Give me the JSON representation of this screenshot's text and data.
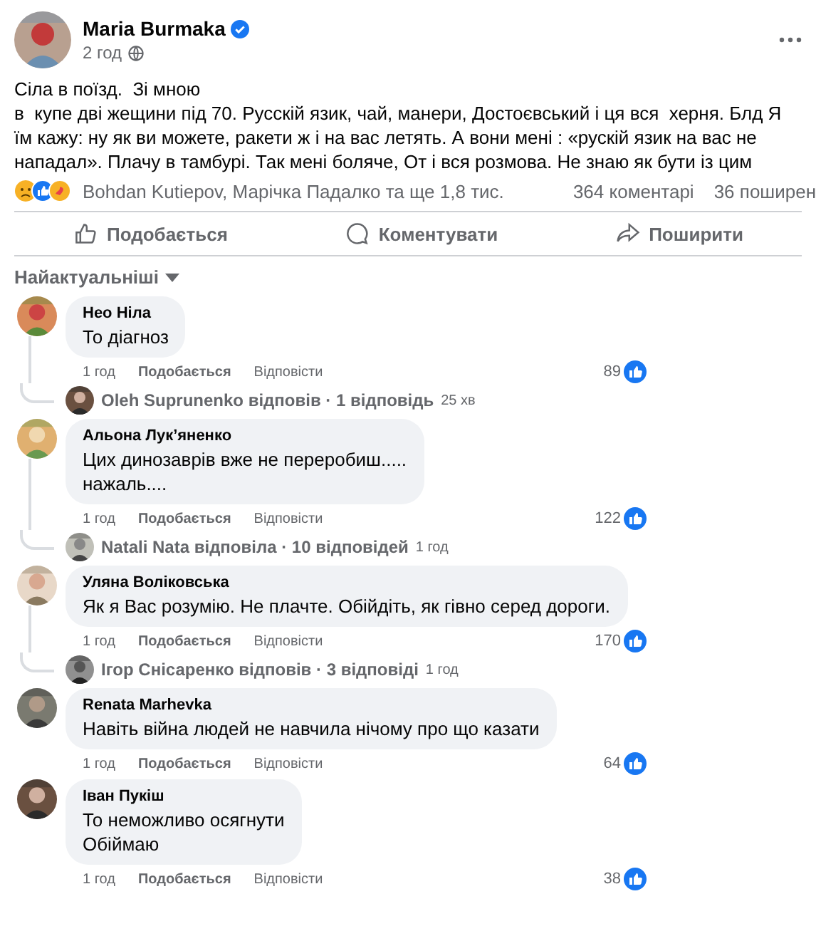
{
  "post": {
    "author": "Maria Burmaka",
    "verified": true,
    "time": "2 год",
    "text": "Сіла в поїзд.  Зі мною\nв  купе дві жещини під 70. Русскій язик, чай, манери, Достоєвський і ця вся  херня. Блд Я їм кажу: ну як ви можете, ракети ж і на вас летять. А вони мені : «рускій язик на вас не нападал». Плачу в тамбурі. Так мені боляче, От і вся розмова. Не знаю як бути із цим",
    "reactors": "Bohdan Kutiepov, Марічка Падалко та ще 1,8 тис.",
    "comments_count": "364 коментарі",
    "shares_count": "36 поширен"
  },
  "actions": [
    {
      "kind": "like",
      "label": "Подобається"
    },
    {
      "kind": "comment",
      "label": "Коментувати"
    },
    {
      "kind": "share",
      "label": "Поширити"
    }
  ],
  "sort": "Найактуальніші",
  "comments": [
    {
      "author": "Нео Ніла",
      "text": "То діагноз",
      "time": "1 год",
      "like": "Подобається",
      "reply": "Відповісти",
      "likes": "89",
      "replies": {
        "summary": "Oleh Suprunenko відповів · 1 відповідь",
        "time": "25 хв"
      }
    },
    {
      "author": "Альона Лук’яненко",
      "text": "Цих динозаврів вже не переробиш.....\nнажаль....",
      "time": "1 год",
      "like": "Подобається",
      "reply": "Відповісти",
      "likes": "122",
      "replies": {
        "summary": "Natali Nata відповіла · 10 відповідей",
        "time": "1 год"
      }
    },
    {
      "author": "Уляна Воліковська",
      "text": "Як я Вас розумію. Не плачте. Обійдіть, як гівно серед дороги.",
      "time": "1 год",
      "like": "Подобається",
      "reply": "Відповісти",
      "likes": "170",
      "replies": {
        "summary": "Ігор Снісаренко відповів · 3 відповіді",
        "time": "1 год"
      }
    },
    {
      "author": "Renata Marhevka",
      "text": "Навіть війна людей не навчила нічому про що казати",
      "time": "1 год",
      "like": "Подобається",
      "reply": "Відповісти",
      "likes": "64"
    },
    {
      "author": "Іван Пукіш",
      "text": "То неможливо осягнути\nОбіймаю",
      "time": "1 год",
      "like": "Подобається",
      "reply": "Відповісти",
      "likes": "38"
    }
  ]
}
